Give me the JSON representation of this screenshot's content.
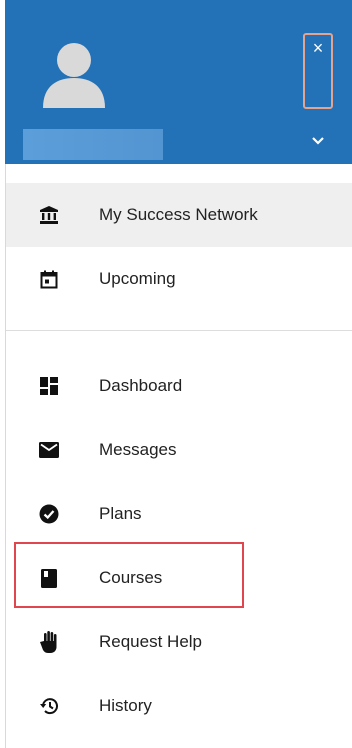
{
  "header": {
    "close_icon": "×",
    "avatar_icon": "user-avatar",
    "expand_icon": "chevron-down"
  },
  "menu_primary": [
    {
      "label": "My Success Network",
      "icon": "institution-icon",
      "active": true
    },
    {
      "label": "Upcoming",
      "icon": "calendar-icon",
      "active": false
    }
  ],
  "menu_secondary": [
    {
      "label": "Dashboard",
      "icon": "dashboard-icon"
    },
    {
      "label": "Messages",
      "icon": "envelope-icon"
    },
    {
      "label": "Plans",
      "icon": "check-circle-icon"
    },
    {
      "label": "Courses",
      "icon": "book-icon"
    },
    {
      "label": "Request Help",
      "icon": "hand-icon"
    },
    {
      "label": "History",
      "icon": "history-icon"
    }
  ],
  "colors": {
    "header_bg": "#2371b6",
    "active_bg": "#efefef",
    "highlight": "#e0464e"
  }
}
